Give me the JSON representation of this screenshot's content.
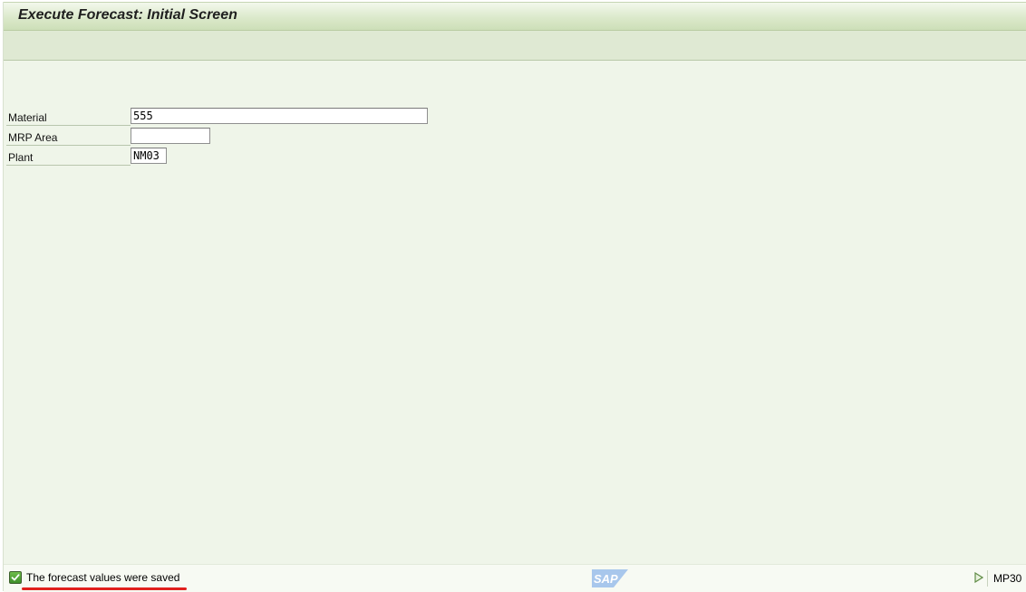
{
  "window": {
    "title": "Execute Forecast: Initial Screen"
  },
  "form": {
    "fields": [
      {
        "label": "Material",
        "value": "555"
      },
      {
        "label": "MRP Area",
        "value": ""
      },
      {
        "label": "Plant",
        "value": "NM03"
      }
    ]
  },
  "status_bar": {
    "message": "The forecast values were saved",
    "message_type": "success",
    "message_icon": "success-check-icon",
    "logo_text": "SAP",
    "nav_icon": "triangle-right-icon",
    "transaction_code": "MP30"
  },
  "colors": {
    "background": "#eff5e9",
    "title_bar": "#dbe9cb",
    "toolbar": "#dfe9d3",
    "success": "#4fa534",
    "highlight_underline": "#e0201d",
    "sap_logo": "#a8c7ec"
  }
}
